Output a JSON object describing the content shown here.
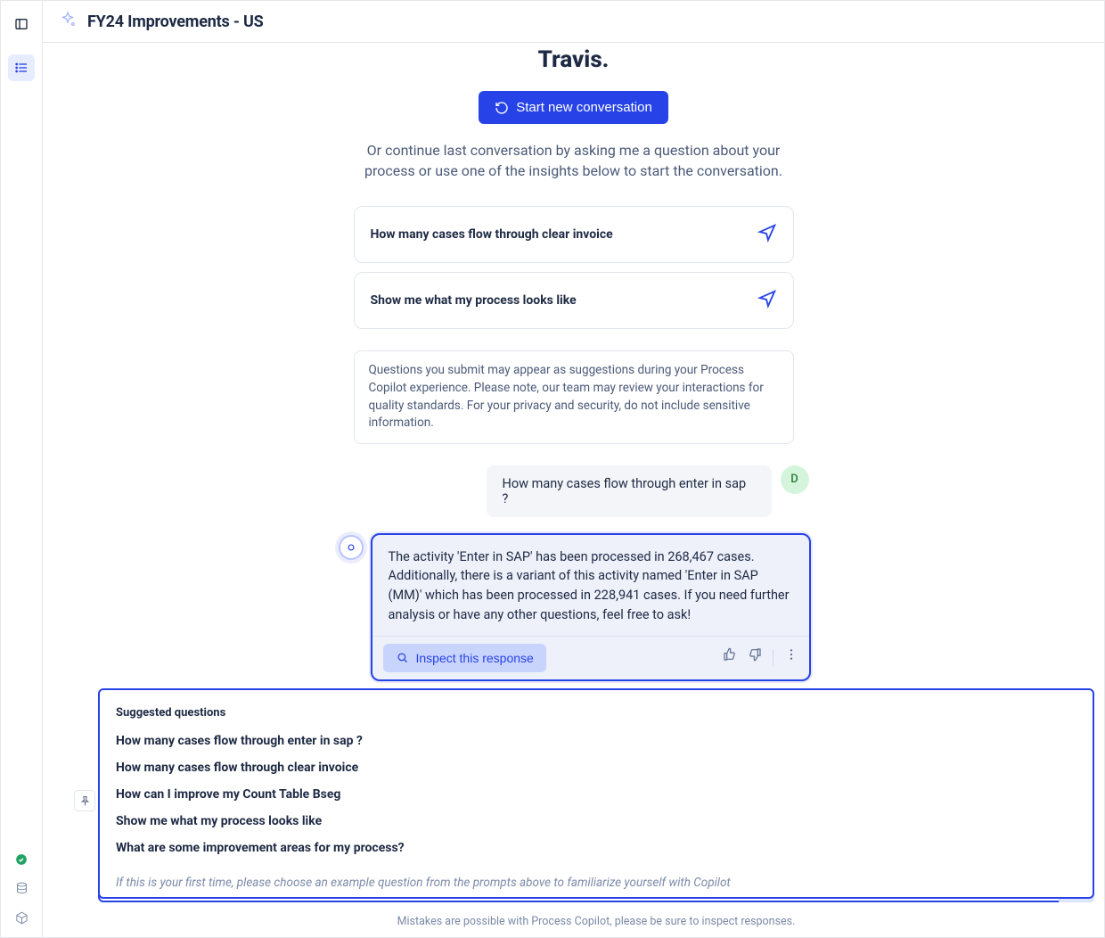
{
  "header": {
    "title": "FY24 Improvements - US"
  },
  "chat": {
    "greeting_name": "Travis.",
    "start_label": "Start new conversation",
    "intro": "Or continue last conversation by asking me a question about your process or use one of the insights below to start the conversation.",
    "prompts": [
      {
        "label": "How many cases flow through clear invoice"
      },
      {
        "label": "Show me what my process looks like"
      }
    ],
    "disclaimer": "Questions you submit may appear as suggestions during your Process Copilot experience. Please note, our team may review your interactions for quality standards. For your privacy and security, do not include sensitive information.",
    "messages": {
      "user_avatar_initial": "D",
      "user_text": "How many cases flow through enter in sap ?",
      "ai_response_1": "The activity 'Enter in SAP' has been processed in 268,467 cases. Additionally, there is a variant of this activity named 'Enter in SAP (MM)' which has been processed in 228,941 cases. If you need further analysis or have any other questions, feel free to ask!",
      "ai_response_2": "The activity 'Enter in SAP' has been processed in 268,467 cases. Additionally, there is a variant of this activity named 'Enter in SAP (MM)' which has been",
      "inspect_label": "Inspect this response"
    }
  },
  "suggestions": {
    "heading": "Suggested questions",
    "items": [
      "How many cases flow through enter in sap ?",
      "How many cases flow through clear invoice",
      "How can I improve my Count Table Bseg",
      "Show me what my process looks like",
      "What are some improvement areas for my process?"
    ],
    "placeholder": "If this is your first time, please choose an example question from the prompts above to familiarize yourself with Copilot"
  },
  "footer": "Mistakes are possible with Process Copilot, please be sure to inspect responses."
}
